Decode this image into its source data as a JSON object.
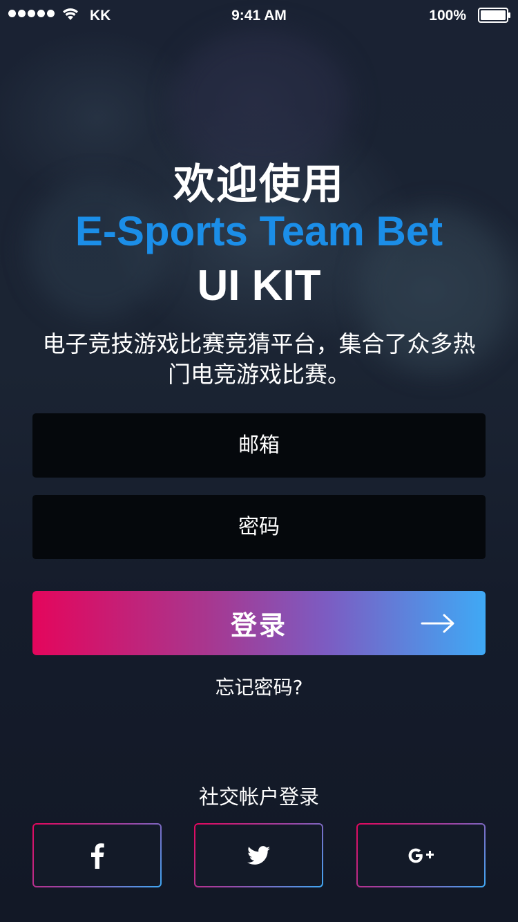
{
  "status_bar": {
    "carrier": "KK",
    "time": "9:41 AM",
    "battery": "100%"
  },
  "hero": {
    "welcome": "欢迎使用",
    "brand": "E-Sports Team Bet",
    "kit": "UI KIT",
    "description": "电子竞技游戏比赛竞猜平台，集合了众多热门电竞游戏比赛。"
  },
  "form": {
    "email_placeholder": "邮箱",
    "password_placeholder": "密码",
    "login_label": "登录",
    "forgot_label": "忘记密码?"
  },
  "social": {
    "title": "社交帐户登录",
    "buttons": [
      {
        "icon": "facebook-icon"
      },
      {
        "icon": "twitter-icon"
      },
      {
        "icon": "google-plus-icon"
      }
    ]
  },
  "colors": {
    "brand_blue": "#1b8ee8",
    "gradient_start": "#e4065c",
    "gradient_end": "#3fa9f5",
    "background": "#131a28",
    "field_background": "#05080c"
  }
}
